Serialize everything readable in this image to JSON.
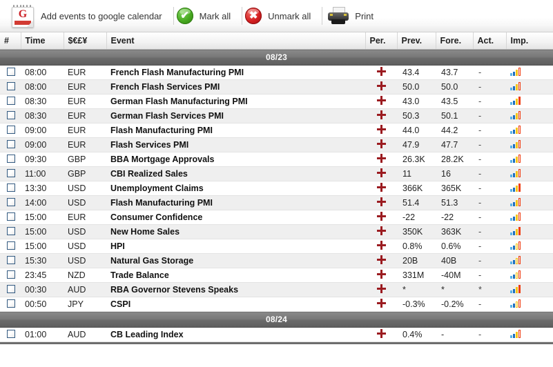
{
  "toolbar": {
    "google_calendar_label": "Add events to google calendar",
    "google_calendar_icon": "google-calendar-icon",
    "mark_all_label": "Mark all",
    "mark_all_icon": "green-check-circle-icon",
    "mark_all_glyph": "✔",
    "unmark_all_label": "Unmark all",
    "unmark_all_icon": "red-cross-circle-icon",
    "unmark_all_glyph": "✖",
    "print_label": "Print",
    "print_icon": "printer-icon"
  },
  "table": {
    "columns": [
      {
        "key": "num",
        "label": "#"
      },
      {
        "key": "time",
        "label": "Time"
      },
      {
        "key": "cur",
        "label": "$€£¥"
      },
      {
        "key": "event",
        "label": "Event"
      },
      {
        "key": "per",
        "label": "Per."
      },
      {
        "key": "prev",
        "label": "Prev."
      },
      {
        "key": "fore",
        "label": "Fore."
      },
      {
        "key": "act",
        "label": "Act."
      },
      {
        "key": "imp",
        "label": "Imp."
      }
    ],
    "groups": [
      {
        "date": "08/23",
        "rows": [
          {
            "time": "08:00",
            "cur": "EUR",
            "event": "French Flash Manufacturing PMI",
            "per": "+",
            "prev": "43.4",
            "fore": "43.7",
            "act": "-",
            "imp": 3
          },
          {
            "time": "08:00",
            "cur": "EUR",
            "event": "French Flash Services PMI",
            "per": "+",
            "prev": "50.0",
            "fore": "50.0",
            "act": "-",
            "imp": 3
          },
          {
            "time": "08:30",
            "cur": "EUR",
            "event": "German Flash Manufacturing PMI",
            "per": "+",
            "prev": "43.0",
            "fore": "43.5",
            "act": "-",
            "imp": 4
          },
          {
            "time": "08:30",
            "cur": "EUR",
            "event": "German Flash Services PMI",
            "per": "+",
            "prev": "50.3",
            "fore": "50.1",
            "act": "-",
            "imp": 3
          },
          {
            "time": "09:00",
            "cur": "EUR",
            "event": "Flash Manufacturing PMI",
            "per": "+",
            "prev": "44.0",
            "fore": "44.2",
            "act": "-",
            "imp": 3
          },
          {
            "time": "09:00",
            "cur": "EUR",
            "event": "Flash Services PMI",
            "per": "+",
            "prev": "47.9",
            "fore": "47.7",
            "act": "-",
            "imp": 3
          },
          {
            "time": "09:30",
            "cur": "GBP",
            "event": "BBA Mortgage Approvals",
            "per": "+",
            "prev": "26.3K",
            "fore": "28.2K",
            "act": "-",
            "imp": 3
          },
          {
            "time": "11:00",
            "cur": "GBP",
            "event": "CBI Realized Sales",
            "per": "+",
            "prev": "11",
            "fore": "16",
            "act": "-",
            "imp": 3
          },
          {
            "time": "13:30",
            "cur": "USD",
            "event": "Unemployment Claims",
            "per": "+",
            "prev": "366K",
            "fore": "365K",
            "act": "-",
            "imp": 4
          },
          {
            "time": "14:00",
            "cur": "USD",
            "event": "Flash Manufacturing PMI",
            "per": "+",
            "prev": "51.4",
            "fore": "51.3",
            "act": "-",
            "imp": 3
          },
          {
            "time": "15:00",
            "cur": "EUR",
            "event": "Consumer Confidence",
            "per": "+",
            "prev": "-22",
            "fore": "-22",
            "act": "-",
            "imp": 3
          },
          {
            "time": "15:00",
            "cur": "USD",
            "event": "New Home Sales",
            "per": "+",
            "prev": "350K",
            "fore": "363K",
            "act": "-",
            "imp": 4
          },
          {
            "time": "15:00",
            "cur": "USD",
            "event": "HPI",
            "per": "+",
            "prev": "0.8%",
            "fore": "0.6%",
            "act": "-",
            "imp": 2
          },
          {
            "time": "15:30",
            "cur": "USD",
            "event": "Natural Gas Storage",
            "per": "+",
            "prev": "20B",
            "fore": "40B",
            "act": "-",
            "imp": 2
          },
          {
            "time": "23:45",
            "cur": "NZD",
            "event": "Trade Balance",
            "per": "+",
            "prev": "331M",
            "fore": "-40M",
            "act": "-",
            "imp": 2
          },
          {
            "time": "00:30",
            "cur": "AUD",
            "event": "RBA Governor Stevens Speaks",
            "per": "+",
            "prev": "*",
            "fore": "*",
            "act": "*",
            "imp": 4
          },
          {
            "time": "00:50",
            "cur": "JPY",
            "event": "CSPI",
            "per": "+",
            "prev": "-0.3%",
            "fore": "-0.2%",
            "act": "-",
            "imp": 2
          }
        ]
      },
      {
        "date": "08/24",
        "rows": [
          {
            "time": "01:00",
            "cur": "AUD",
            "event": "CB Leading Index",
            "per": "+",
            "prev": "0.4%",
            "fore": "-",
            "act": "-",
            "imp": 3
          }
        ]
      }
    ]
  },
  "colors": {
    "date_band": "#6a6a6a",
    "plus": "#9b1b20",
    "checkbox_border": "#31587f",
    "imp_bar_1": "#5ab4e8",
    "imp_bar_2": "#1c6fc0",
    "imp_bar_3": "#f5c518",
    "imp_bar_4": "#ef3b11",
    "row_alt": "#efefef"
  }
}
